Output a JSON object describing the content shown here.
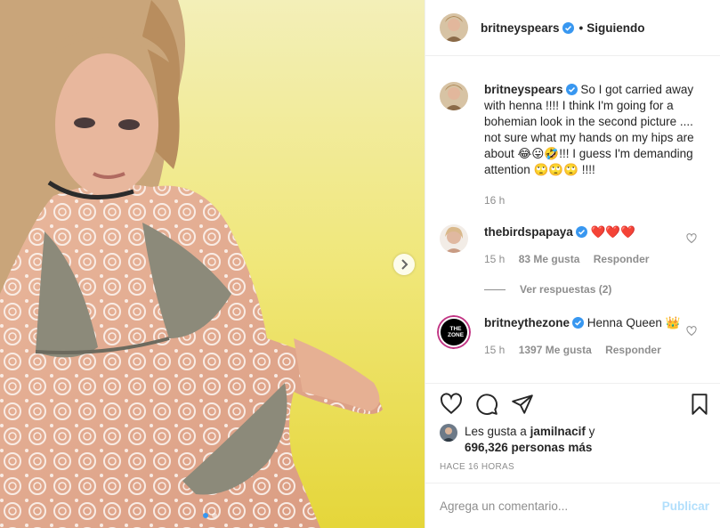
{
  "header": {
    "username": "britneyspears",
    "separator": "•",
    "follow_status": "Siguiendo"
  },
  "caption": {
    "username": "britneyspears",
    "text": "So I got carried away with henna !!!!  I think I'm going for a bohemian look in the second picture .... not sure what my hands on my hips are about 😂😛🤣!!! I guess I'm demanding attention 🙄🙄🙄 !!!!",
    "time": "16 h"
  },
  "comments": [
    {
      "username": "thebirdspapaya",
      "text": "❤️❤️❤️",
      "time": "15 h",
      "likes": "83 Me gusta",
      "reply": "Responder"
    },
    {
      "username": "britneythezone",
      "text": "Henna Queen 👑",
      "time": "15 h",
      "likes": "1397 Me gusta",
      "reply": "Responder",
      "avatar_text": "THE ZONE"
    }
  ],
  "view_replies": "Ver respuestas (2)",
  "likes": {
    "prefix": "Les gusta a",
    "user": "jamilnacif",
    "suffix": "y",
    "others": "696,326 personas más"
  },
  "posted_ago": "HACE 16 HORAS",
  "comment_box": {
    "placeholder": "Agrega un comentario...",
    "publish": "Publicar"
  },
  "carousel": {
    "total_slides": 2,
    "current_slide": 1
  },
  "colors": {
    "verified": "#3897f0",
    "link_disabled": "#b2dffc",
    "muted": "#8e8e8e",
    "heart": "#ed4956"
  }
}
